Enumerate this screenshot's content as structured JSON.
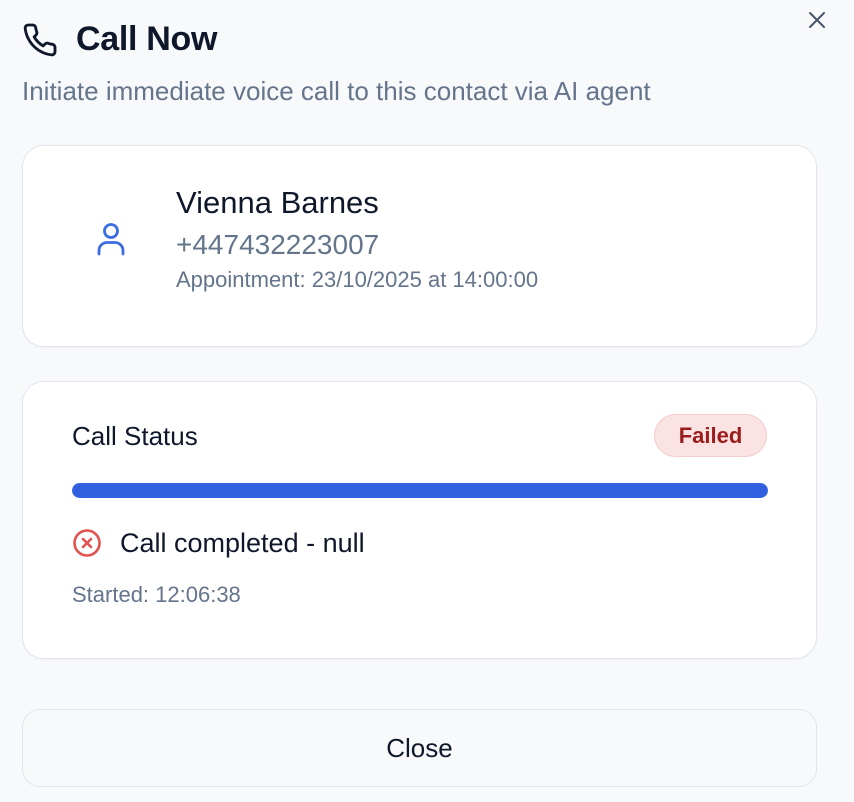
{
  "dialog": {
    "title": "Call Now",
    "subtitle": "Initiate immediate voice call to this contact via AI agent",
    "title_icon": "phone-icon",
    "close_icon": "close-icon"
  },
  "contact": {
    "icon": "user-icon",
    "name": "Vienna Barnes",
    "phone": "+447432223007",
    "appointment": "Appointment: 23/10/2025 at 14:00:00"
  },
  "call_status": {
    "title": "Call Status",
    "badge": "Failed",
    "progress_percent": 100,
    "result_icon": "x-circle-icon",
    "result_text": "Call completed - null",
    "started": "Started: 12:06:38"
  },
  "footer": {
    "close_label": "Close"
  },
  "colors": {
    "accent": "#3161e0",
    "badge_bg": "#fbe3e3",
    "badge_text": "#9b1c1c",
    "error_icon": "#e0534f",
    "muted_text": "#64748b"
  }
}
